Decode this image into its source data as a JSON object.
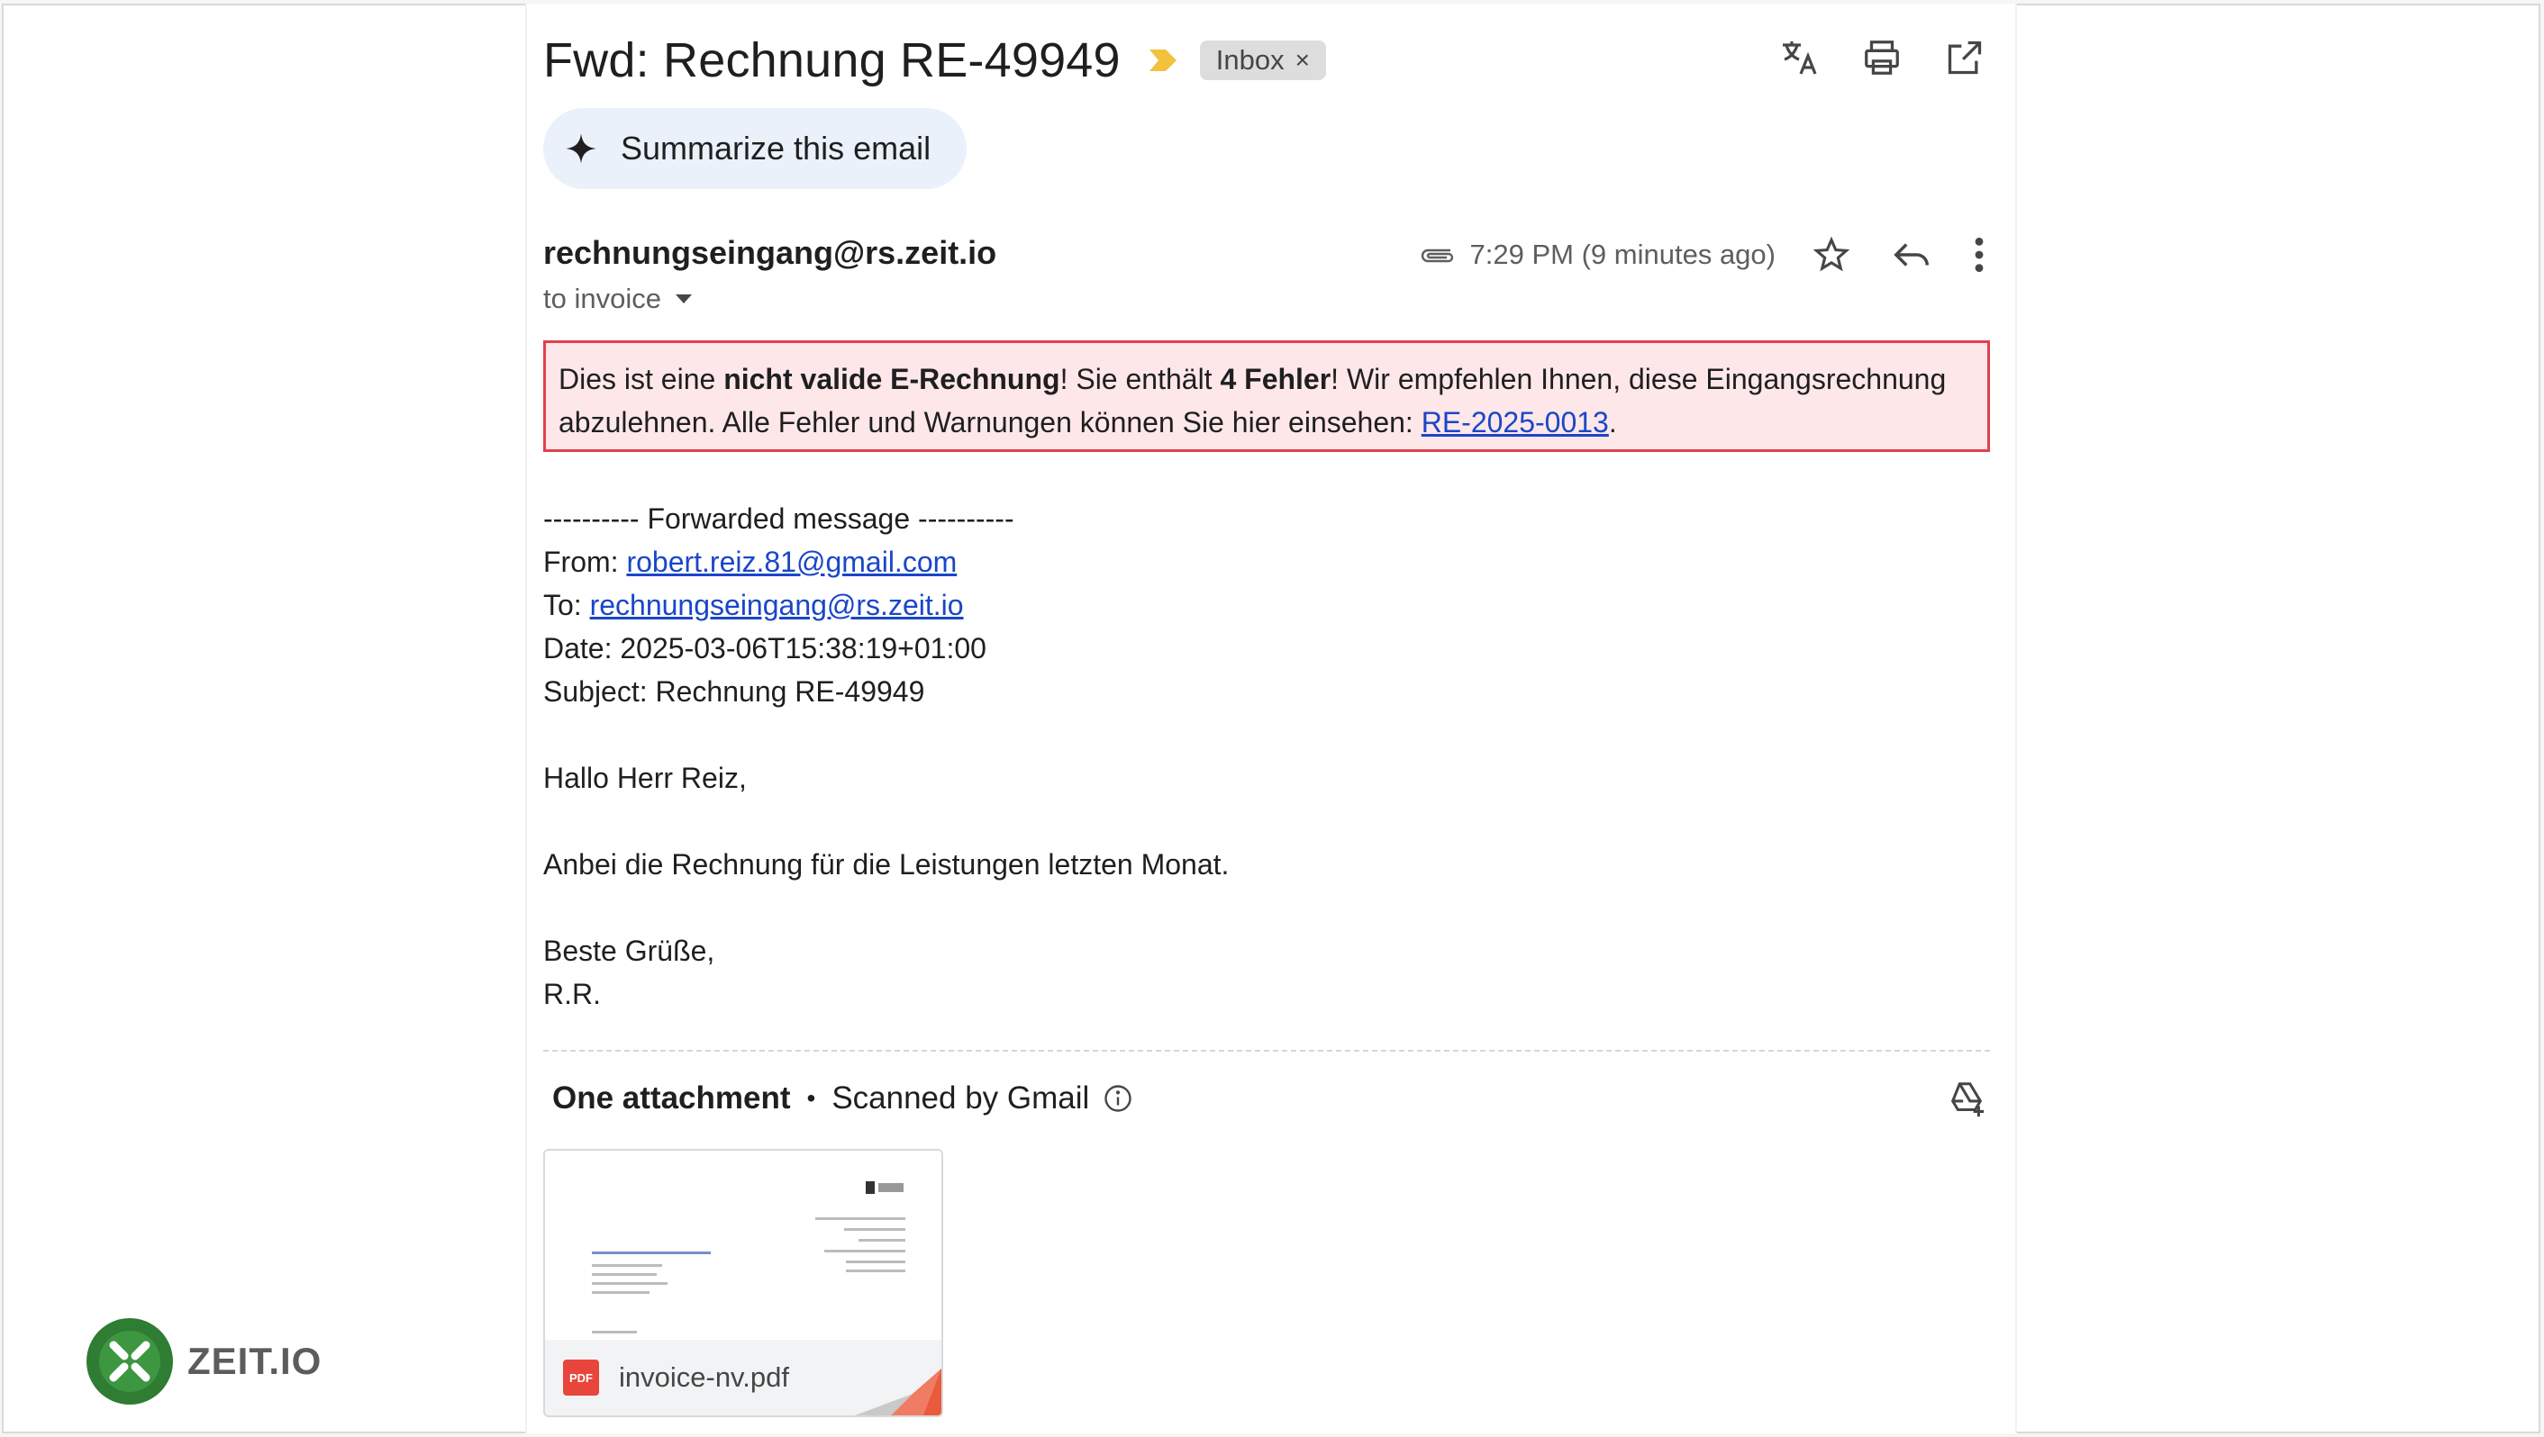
{
  "email": {
    "subject": "Fwd: Rechnung RE-49949",
    "label": "Inbox",
    "label_remove": "×",
    "summarize_label": "Summarize this email",
    "sender": "rechnungseingang@rs.zeit.io",
    "recipient": "to invoice",
    "time": "7:29 PM (9 minutes ago)"
  },
  "warning": {
    "p1": "Dies ist eine ",
    "b1": "nicht valide E-Rechnung",
    "p2": "! Sie enthält ",
    "b2": "4 Fehler",
    "p3": "! Wir empfehlen Ihnen, diese Eingangsrechnung abzulehnen. Alle Fehler und Warnungen können Sie hier einsehen: ",
    "link": "RE-2025-0013",
    "p4": "."
  },
  "forwarded": {
    "header": "---------- Forwarded message ----------",
    "from_label": "From: ",
    "from": "robert.reiz.81@gmail.com",
    "to_label": "To: ",
    "to": "rechnungseingang@rs.zeit.io",
    "date": "Date: 2025-03-06T15:38:19+01:00",
    "subject": "Subject: Rechnung RE-49949"
  },
  "message": {
    "greeting": "Hallo Herr Reiz,",
    "body": "Anbei die Rechnung für die Leistungen letzten Monat.",
    "closing": "Beste Grüße,",
    "signature": "R.R."
  },
  "attachments": {
    "count_label": "One attachment",
    "separator": "•",
    "scanned": "Scanned by Gmail",
    "file_name": "invoice-nv.pdf",
    "file_type": "PDF"
  },
  "brand": {
    "logo_text": "ZEIT.IO",
    "logo_color": "#2e7d32"
  },
  "colors": {
    "warning_bg": "#fde7e9",
    "warning_border": "#e0404d",
    "link": "#1a46c8",
    "importance": "#f2c23d"
  }
}
